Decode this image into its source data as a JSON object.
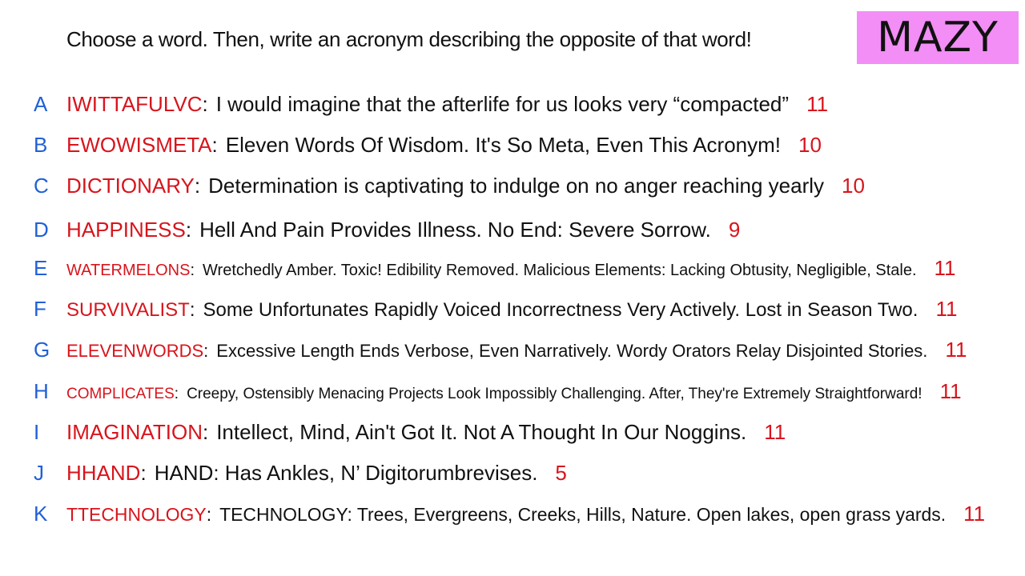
{
  "prompt": "Choose a word. Then, write an acronym describing the opposite of that word!",
  "badge": "MAZY",
  "colors": {
    "letter": "#2060d8",
    "word": "#d8141c",
    "count": "#d8141c",
    "badge_bg": "#f28ef5"
  },
  "rows": [
    {
      "letter": "A",
      "word": "IWITTAFULVC",
      "desc": "I would imagine that the afterlife for us looks very “compacted”",
      "count": "11"
    },
    {
      "letter": "B",
      "word": "EWOWISMETA",
      "desc": "Eleven Words Of Wisdom. It's So Meta, Even This Acronym!",
      "count": "10"
    },
    {
      "letter": "C",
      "word": "DICTIONARY",
      "desc": "Determination is captivating to indulge on no anger reaching yearly",
      "count": "10"
    },
    {
      "letter": "D",
      "word": "HAPPINESS",
      "desc": "Hell And Pain Provides Illness. No End: Severe Sorrow.",
      "count": "9"
    },
    {
      "letter": "E",
      "word": "WATERMELONS",
      "desc": "Wretchedly Amber. Toxic! Edibility Removed. Malicious Elements: Lacking Obtusity, Negligible, Stale.",
      "count": "11"
    },
    {
      "letter": "F",
      "word": "SURVIVALIST",
      "desc": "Some Unfortunates Rapidly Voiced Incorrectness Very Actively. Lost in Season Two.",
      "count": "11"
    },
    {
      "letter": "G",
      "word": "ELEVENWORDS",
      "desc": "Excessive Length Ends Verbose, Even Narratively. Wordy Orators Relay Disjointed Stories.",
      "count": "11"
    },
    {
      "letter": "H",
      "word": "COMPLICATES",
      "desc": "Creepy, Ostensibly Menacing Projects Look Impossibly Challenging. After, They're Extremely Straightforward!",
      "count": "11"
    },
    {
      "letter": "I",
      "word": "IMAGINATION",
      "desc": "Intellect, Mind, Ain't Got It. Not A Thought In Our Noggins.",
      "count": "11"
    },
    {
      "letter": "J",
      "word": "HHAND",
      "desc": "HAND: Has Ankles, N’ Digitorumbrevises.",
      "count": "5"
    },
    {
      "letter": "K",
      "word": "TTECHNOLOGY",
      "desc": "TECHNOLOGY: Trees, Evergreens, Creeks, Hills, Nature. Open lakes, open grass yards.",
      "count": "11"
    }
  ]
}
